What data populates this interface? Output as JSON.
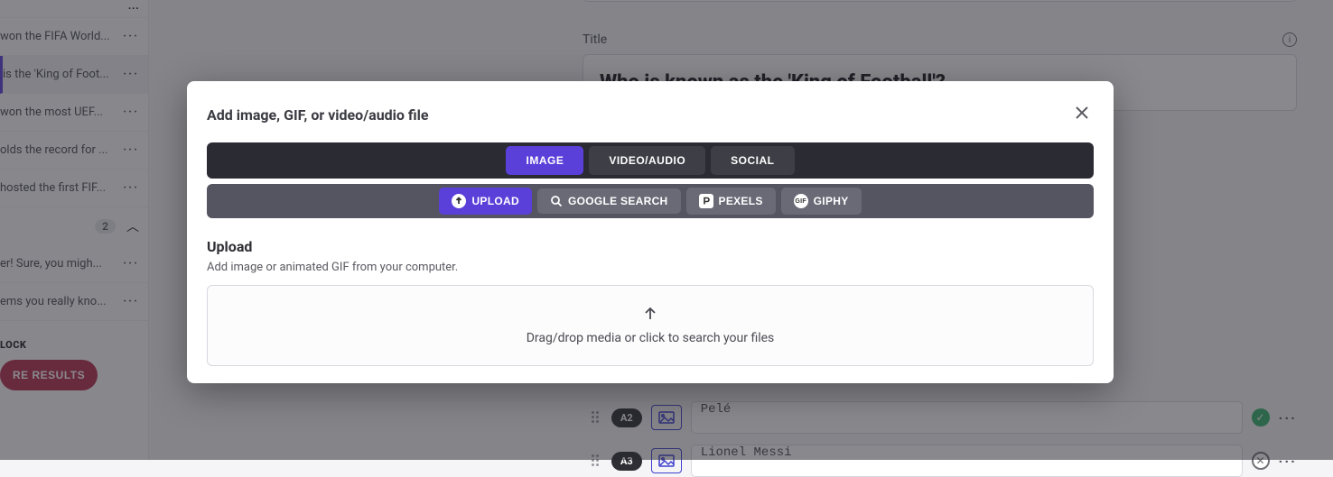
{
  "sidebar": {
    "items": [
      {
        "label": "won the FIFA World..."
      },
      {
        "label": "is the 'King of Foot..."
      },
      {
        "label": "won the most UEF..."
      },
      {
        "label": "olds the record for ..."
      },
      {
        "label": "hosted the first FIF..."
      }
    ],
    "extra": [
      {
        "label": "er! Sure, you migh..."
      },
      {
        "label": "ems you really kno..."
      }
    ],
    "count": "2",
    "block_label": "LOCK",
    "results_btn": "RE RESULTS"
  },
  "main": {
    "title_label": "Title",
    "title_value": "Who is known as the 'King of Football'?",
    "answers": [
      {
        "badge": "A2",
        "value": "Pelé",
        "status": "ok"
      },
      {
        "badge": "A3",
        "value": "Lionel Messi",
        "status": "no"
      }
    ]
  },
  "modal": {
    "title": "Add image, GIF, or video/audio file",
    "tabs": {
      "image": "IMAGE",
      "video": "VIDEO/AUDIO",
      "social": "SOCIAL"
    },
    "subtabs": {
      "upload": "UPLOAD",
      "google": "GOOGLE SEARCH",
      "pexels": "PEXELS",
      "giphy": "GIPHY"
    },
    "section_title": "Upload",
    "section_sub": "Add image or animated GIF from your computer.",
    "dropzone_text": "Drag/drop media or click to search your files"
  }
}
